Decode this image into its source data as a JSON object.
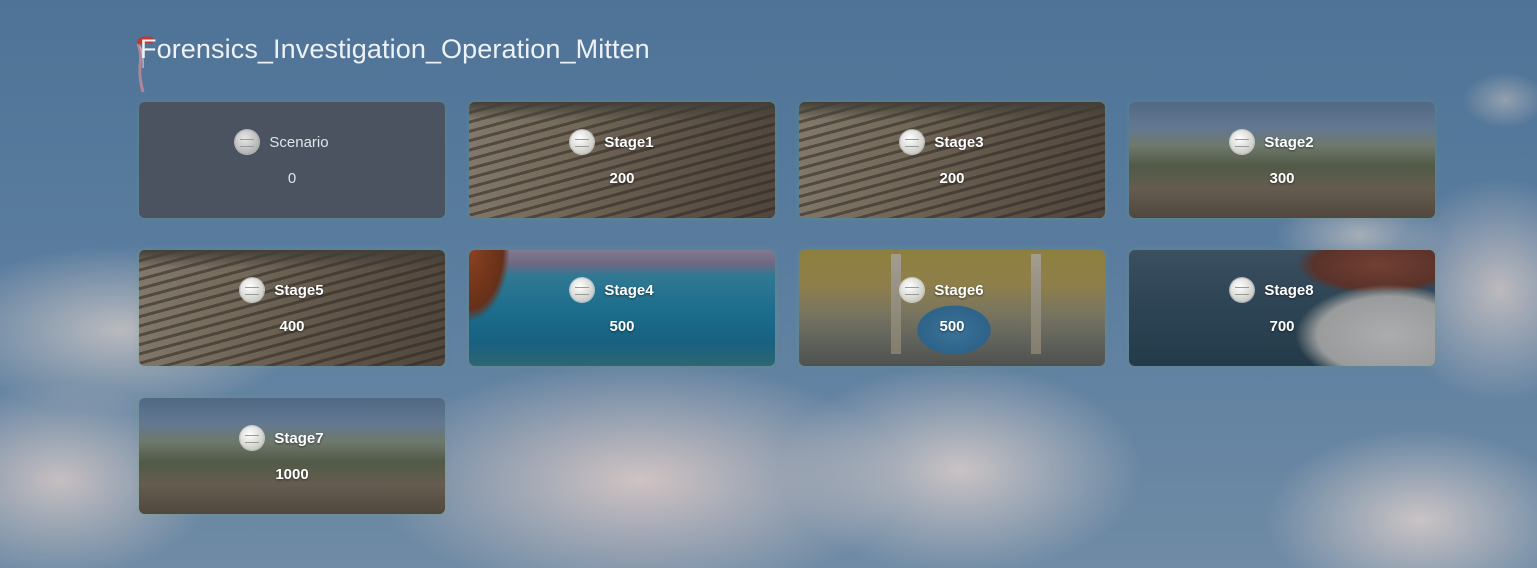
{
  "page": {
    "title": "Forensics_Investigation_Operation_Mitten"
  },
  "cards": [
    {
      "name": "Scenario",
      "points": "0",
      "scene": "scenario"
    },
    {
      "name": "Stage1",
      "points": "200",
      "scene": "amphitheater"
    },
    {
      "name": "Stage3",
      "points": "200",
      "scene": "amphitheater"
    },
    {
      "name": "Stage2",
      "points": "300",
      "scene": "citadel"
    },
    {
      "name": "Stage5",
      "points": "400",
      "scene": "amphitheater"
    },
    {
      "name": "Stage4",
      "points": "500",
      "scene": "sea-harbor"
    },
    {
      "name": "Stage6",
      "points": "500",
      "scene": "mosque"
    },
    {
      "name": "Stage8",
      "points": "700",
      "scene": "dead-sea"
    },
    {
      "name": "Stage7",
      "points": "1000",
      "scene": "citadel"
    }
  ],
  "icons": {
    "logo": "red-flag-icon",
    "card_badge": "coin-badge-icon"
  },
  "colors": {
    "title_text": "#eef2f6",
    "scenario_card_bg": "#4a535f",
    "logo_red": "#c0392b"
  }
}
